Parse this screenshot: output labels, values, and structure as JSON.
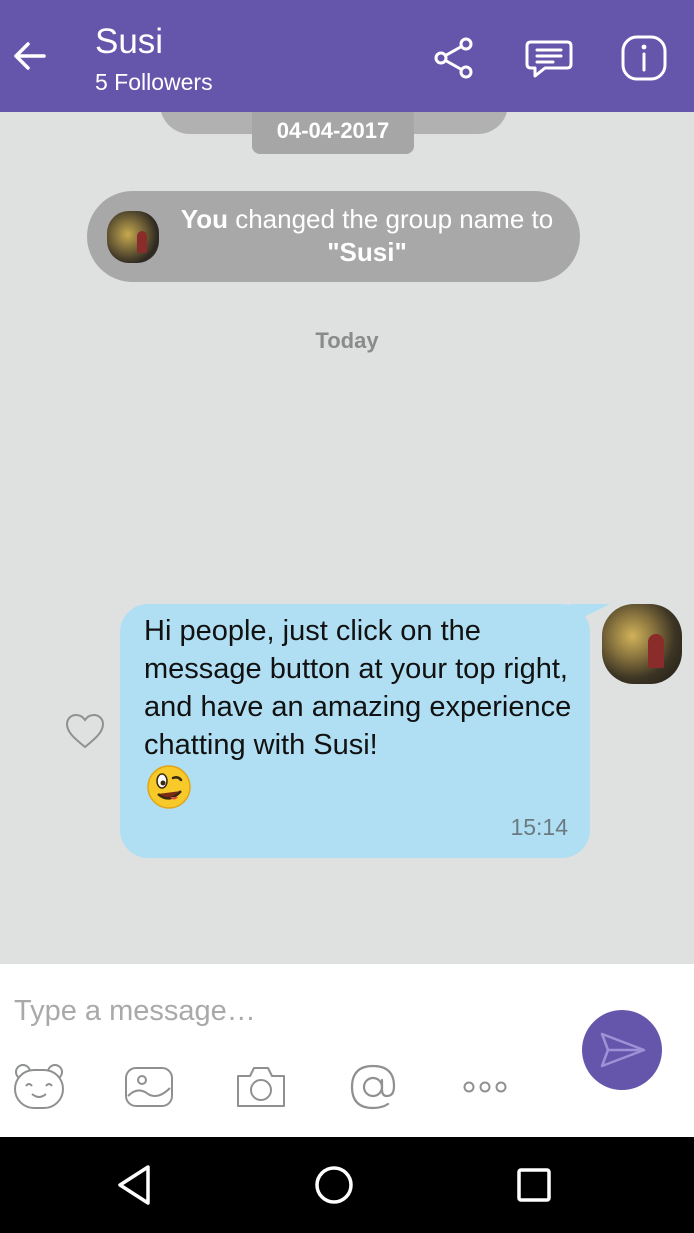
{
  "header": {
    "title": "Susi",
    "subtitle": "5 Followers",
    "icons": [
      "back-arrow-icon",
      "share-icon",
      "chat-icon",
      "info-icon"
    ],
    "color": "#6656ab"
  },
  "chat": {
    "date_pill": "04-04-2017",
    "system_message": {
      "bold_prefix": "You",
      "text_mid": " changed the group name to ",
      "name_quoted": "\"Susi\""
    },
    "day_label": "Today",
    "message": {
      "text": "Hi people, just click on the message button at your top right, and have an amazing experience chatting with Susi!",
      "emoji": "winking-face-emoji",
      "time": "15:14",
      "bubble_color": "#b0dff3"
    }
  },
  "composer": {
    "placeholder": "Type a message…",
    "tools": [
      "emoji-icon",
      "gallery-icon",
      "camera-icon",
      "mention-icon",
      "more-icon"
    ],
    "send_icon": "send-icon"
  },
  "navbar": {
    "buttons": [
      "nav-back-icon",
      "nav-home-icon",
      "nav-recents-icon"
    ]
  }
}
